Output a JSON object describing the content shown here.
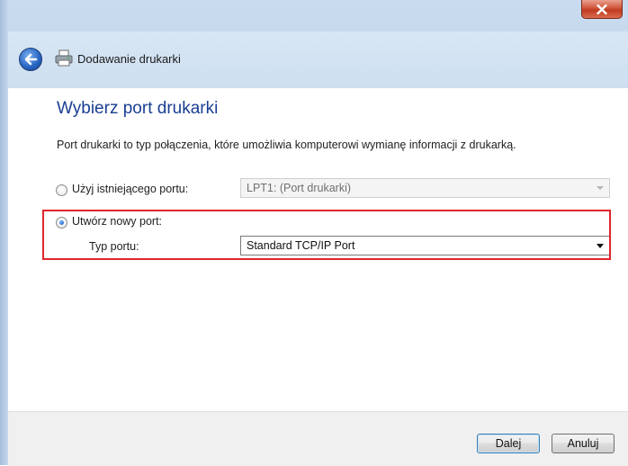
{
  "window": {
    "title": "Dodawanie drukarki"
  },
  "page": {
    "heading": "Wybierz port drukarki",
    "description": "Port drukarki to typ połączenia, które umożliwia komputerowi wymianę informacji z drukarką."
  },
  "options": {
    "existing_port": {
      "label": "Użyj istniejącego portu:",
      "selected": false,
      "dropdown_value": "LPT1: (Port drukarki)",
      "enabled": false
    },
    "new_port": {
      "label": "Utwórz nowy port:",
      "selected": true,
      "type_label": "Typ portu:",
      "dropdown_value": "Standard TCP/IP Port",
      "enabled": true
    }
  },
  "footer": {
    "next_label": "Dalej",
    "cancel_label": "Anuluj"
  },
  "colors": {
    "heading": "#1a3f91",
    "highlight": "#e0252d",
    "close_button": "#c03b1f"
  },
  "icons": {
    "back": "back-arrow-icon",
    "printer": "printer-icon",
    "close": "close-icon"
  }
}
